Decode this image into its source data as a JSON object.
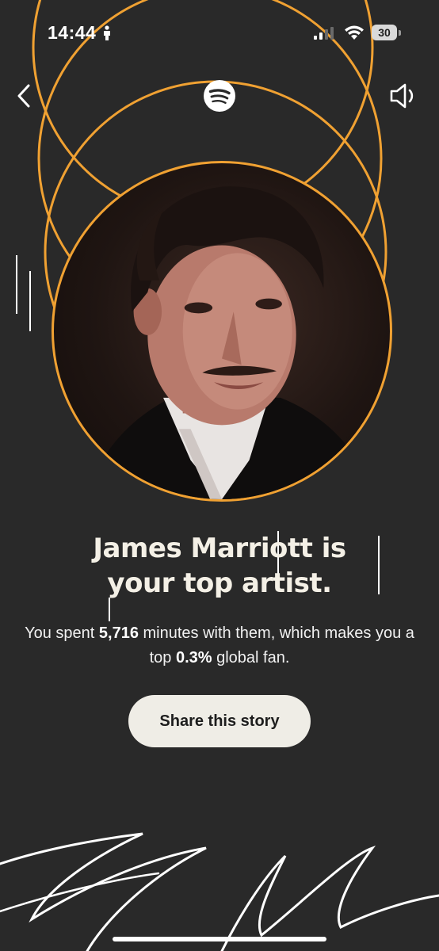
{
  "status_bar": {
    "time": "14:44",
    "battery": "30"
  },
  "nav": {
    "back_icon": "chevron-left-icon",
    "logo_icon": "spotify-logo-icon",
    "sound_icon": "speaker-icon"
  },
  "story": {
    "headline_line1": "James Marriott is",
    "headline_line2": "your top artist.",
    "sub_prefix": "You spent ",
    "minutes": "5,716",
    "sub_middle": " minutes with them, which makes you a top ",
    "percent": "0.3%",
    "sub_suffix": " global fan.",
    "share_label": "Share this story"
  },
  "colors": {
    "background": "#292929",
    "ring": "#f0a132",
    "button_bg": "#efede6",
    "headline": "#f4f0e6"
  }
}
